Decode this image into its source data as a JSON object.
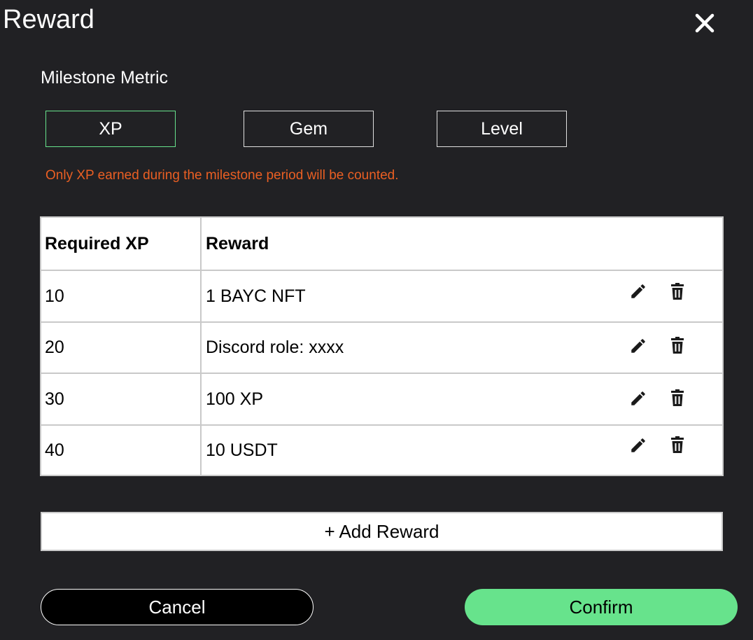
{
  "dialog": {
    "title": "Reward",
    "close_icon": "close-icon"
  },
  "metric": {
    "label": "Milestone Metric",
    "options": [
      {
        "label": "XP",
        "selected": true
      },
      {
        "label": "Gem",
        "selected": false
      },
      {
        "label": "Level",
        "selected": false
      }
    ],
    "hint": "Only XP earned during the milestone period will be counted."
  },
  "table": {
    "headers": [
      "Required XP",
      "Reward"
    ],
    "rows": [
      {
        "required": "10",
        "reward": "1 BAYC NFT"
      },
      {
        "required": "20",
        "reward": "Discord role: xxxx"
      },
      {
        "required": "30",
        "reward": "100 XP"
      },
      {
        "required": "40",
        "reward": "10 USDT"
      }
    ],
    "row_icons": [
      "pencil-icon",
      "trash-icon"
    ]
  },
  "actions": {
    "add_reward": "+ Add Reward",
    "cancel": "Cancel",
    "confirm": "Confirm"
  },
  "colors": {
    "background": "#212124",
    "accent_green": "#67e38c",
    "hint_orange": "#ea5f23",
    "table_border": "#c9c9c9"
  }
}
